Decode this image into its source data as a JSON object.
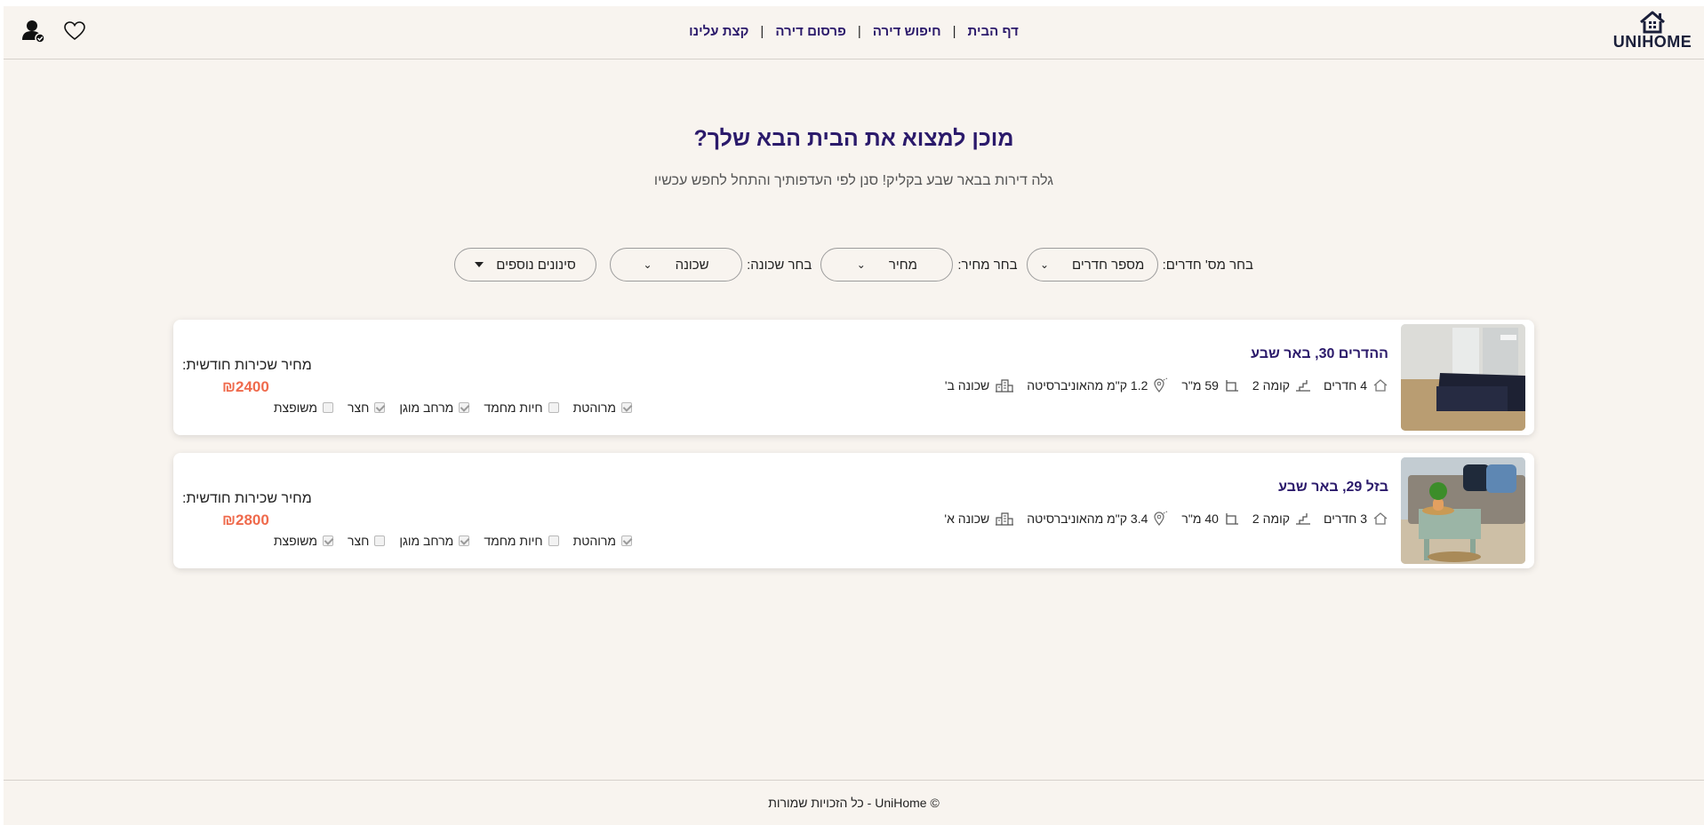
{
  "brand": {
    "name": "UNIHOME"
  },
  "nav": {
    "items": [
      "דף הבית",
      "חיפוש דירה",
      "פרסום דירה",
      "קצת עלינו"
    ],
    "separator": "|"
  },
  "header_icons": [
    "heart-icon",
    "user-check-icon"
  ],
  "hero": {
    "title": "מוכן למצוא את הבית הבא שלך?",
    "subtitle": "גלה דירות בבאר שבע בקליק! סנן לפי העדפותיך והתחל לחפש עכשיו"
  },
  "filters": {
    "rooms_label": "בחר מס' חדרים:",
    "rooms_value": "מספר חדרים",
    "price_label": "בחר מחיר:",
    "price_value": "מחיר",
    "hood_label": "בחר שכונה:",
    "hood_value": "שכונה",
    "more_label": "סינונים נוספים"
  },
  "listings": [
    {
      "title": "ההדרים 30, באר שבע",
      "rooms": "4 חדרים",
      "floor": "קומה 2",
      "size": "59 מ\"ר",
      "distance": "1.2 ק\"מ מהאוניברסיטה",
      "neighborhood": "שכונה ב'",
      "amenities": [
        {
          "label": "מרוהטת",
          "checked": true
        },
        {
          "label": "חיות מחמד",
          "checked": false
        },
        {
          "label": "מרחב מוגן",
          "checked": true
        },
        {
          "label": "חצר",
          "checked": true
        },
        {
          "label": "משופצת",
          "checked": false
        }
      ],
      "price_label": "מחיר שכירות חודשית:",
      "price": "₪2400"
    },
    {
      "title": "בזל 29, באר שבע",
      "rooms": "3 חדרים",
      "floor": "קומה 2",
      "size": "40 מ\"ר",
      "distance": "3.4 ק\"מ מהאוניברסיטה",
      "neighborhood": "שכונה א'",
      "amenities": [
        {
          "label": "מרוהטת",
          "checked": true
        },
        {
          "label": "חיות מחמד",
          "checked": false
        },
        {
          "label": "מרחב מוגן",
          "checked": true
        },
        {
          "label": "חצר",
          "checked": false
        },
        {
          "label": "משופצת",
          "checked": true
        }
      ],
      "price_label": "מחיר שכירות חודשית:",
      "price": "₪2800"
    }
  ],
  "footer": {
    "text": "© UniHome - כל הזכויות שמורות"
  },
  "colors": {
    "accent": "#2b1a6b",
    "price": "#ef6a4c",
    "background": "#f8f4ef"
  }
}
